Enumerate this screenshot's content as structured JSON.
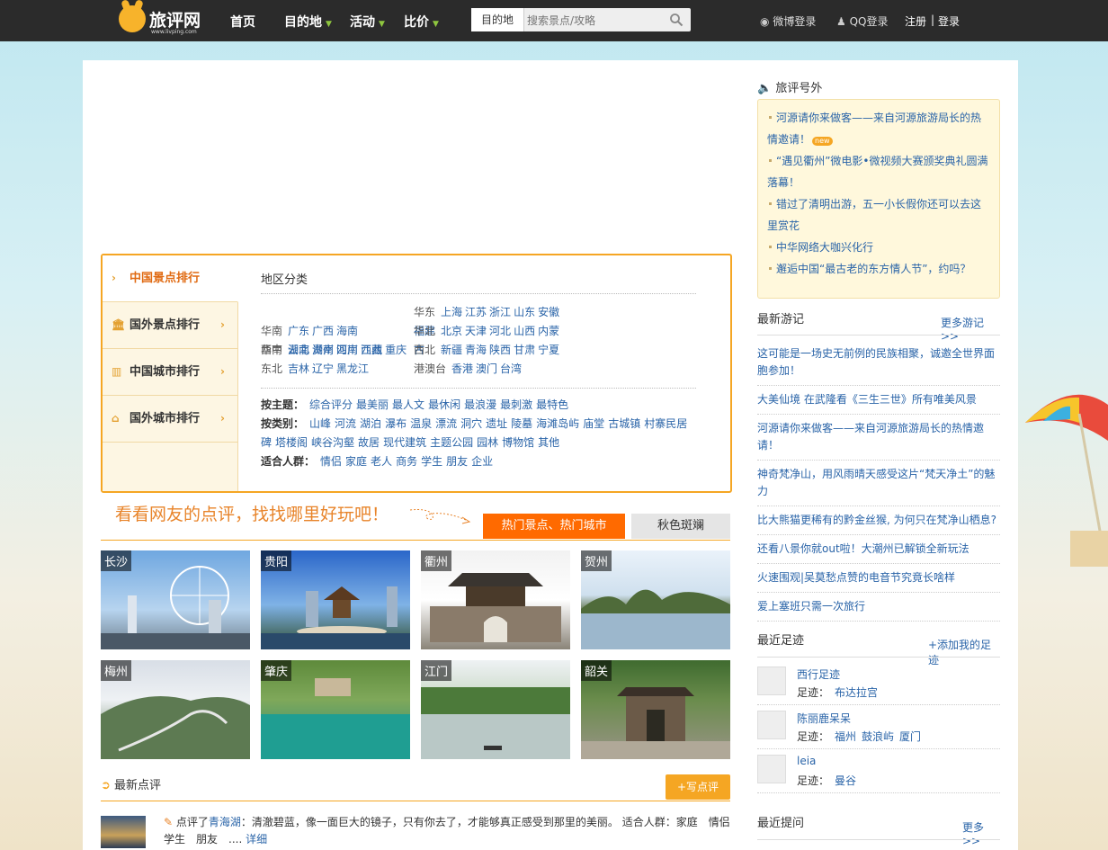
{
  "header": {
    "logo_text": "旅评网",
    "logo_sub": "www.livping.com",
    "nav": [
      {
        "label": "首页",
        "has_dropdown": false
      },
      {
        "label": "目的地",
        "has_dropdown": true
      },
      {
        "label": "活动",
        "has_dropdown": true
      },
      {
        "label": "比价",
        "has_dropdown": true
      }
    ],
    "search": {
      "select_label": "目的地",
      "placeholder": "搜索景点/攻略"
    },
    "weibo_login": "微博登录",
    "qq_login": "QQ登录",
    "register": "注册",
    "sep": "|",
    "login": "登录"
  },
  "rank": {
    "tabs": [
      {
        "label": "中国景点排行",
        "active": true
      },
      {
        "label": "国外景点排行",
        "active": false
      },
      {
        "label": "中国城市排行",
        "active": false
      },
      {
        "label": "国外城市排行",
        "active": false
      }
    ],
    "title": "地区分类",
    "regions": [
      {
        "name": "华南",
        "items": [
          "广东",
          "广西",
          "海南"
        ]
      },
      {
        "name": "华东",
        "items": [
          "上海",
          "江苏",
          "浙江",
          "山东",
          "安徽",
          "福建"
        ]
      },
      {
        "name": "华中",
        "items": [
          "湖北",
          "湖南",
          "河南",
          "江西"
        ]
      },
      {
        "name": "华北",
        "items": [
          "北京",
          "天津",
          "河北",
          "山西",
          "内蒙古"
        ]
      },
      {
        "name": "西南",
        "items": [
          "云南",
          "贵州",
          "四川",
          "西藏",
          "重庆"
        ]
      },
      {
        "name": "西北",
        "items": [
          "新疆",
          "青海",
          "陕西",
          "甘肃",
          "宁夏"
        ]
      },
      {
        "name": "东北",
        "items": [
          "吉林",
          "辽宁",
          "黑龙江"
        ]
      },
      {
        "name": "港澳台",
        "items": [
          "香港",
          "澳门",
          "台湾"
        ]
      }
    ],
    "themes": [
      {
        "label": "按主题：",
        "items": [
          "综合评分",
          "最美丽",
          "最人文",
          "最休闲",
          "最浪漫",
          "最刺激",
          "最特色"
        ]
      },
      {
        "label": "按类别：",
        "items": [
          "山峰",
          "河流",
          "湖泊",
          "瀑布",
          "温泉",
          "漂流",
          "洞穴",
          "遗址",
          "陵墓",
          "海滩岛屿",
          "庙堂",
          "古城镇",
          "村寨民居",
          "碑",
          "塔楼阁",
          "峡谷沟壑",
          "故居",
          "现代建筑",
          "主题公园",
          "园林",
          "博物馆",
          "其他"
        ]
      },
      {
        "label": "适合人群：",
        "items": [
          "情侣",
          "家庭",
          "老人",
          "商务",
          "学生",
          "朋友",
          "企业"
        ]
      }
    ]
  },
  "slogan": "看看网友的点评，找找哪里好玩吧！",
  "city_tabs": [
    "热门景点、热门城市",
    "秋色斑斓"
  ],
  "cities": [
    "长沙",
    "贵阳",
    "衢州",
    "贺州",
    "梅州",
    "肇庆",
    "江门",
    "韶关"
  ],
  "latest_review": {
    "heading": "最新点评",
    "write_btn": "+写点评",
    "prefix": "点评了",
    "place": "青海湖",
    "text": "：清澈碧蓝，像一面巨大的镜子，只有你去了，才能够真正感受到那里的美丽。 适合人群：家庭　情侣　学生　朋友　....",
    "detail": "详细"
  },
  "sidebar": {
    "news_title": "旅评号外",
    "news": [
      {
        "text": "河源请你来做客——来自河源旅游局长的热情邀请！",
        "new": true
      },
      {
        "text": "“遇见衢州”微电影•微视频大赛颁奖典礼圆满落幕！",
        "new": false
      },
      {
        "text": "错过了清明出游，五一小长假你还可以去这里赏花",
        "new": false
      },
      {
        "text": "中华网络大咖兴化行",
        "new": false
      },
      {
        "text": "邂逅中国“最古老的东方情人节”，约吗？",
        "new": false
      }
    ],
    "new_tag": "new",
    "journals_title": "最新游记",
    "journals_more": "更多游记>>",
    "journals": [
      "这可能是一场史无前例的民族相聚，诚邀全世界面胞参加！",
      "大美仙境 在武隆看《三生三世》所有唯美风景",
      "河源请你来做客——来自河源旅游局长的热情邀请！",
      "神奇梵净山，用风雨晴天感受这片“梵天净土”的魅力",
      "比大熊猫更稀有的黔金丝猴, 为何只在梵净山栖息?",
      "还看八景你就out啦！大潮州已解锁全新玩法",
      "火速围观|吴莫愁点赞的电音节究竟长啥样",
      "爱上塞班只需一次旅行"
    ],
    "footprints_title": "最近足迹",
    "footprints_add": "+添加我的足迹",
    "footprint_label": "足迹：",
    "footprints": [
      {
        "name": "西行足迹",
        "places": [
          "布达拉宫"
        ]
      },
      {
        "name": "陈丽鹿呆呆",
        "places": [
          "福州",
          "鼓浪屿",
          "厦门"
        ]
      },
      {
        "name": "leia",
        "places": [
          "曼谷"
        ]
      }
    ],
    "questions_title": "最近提问",
    "questions_more": "更多>>"
  }
}
